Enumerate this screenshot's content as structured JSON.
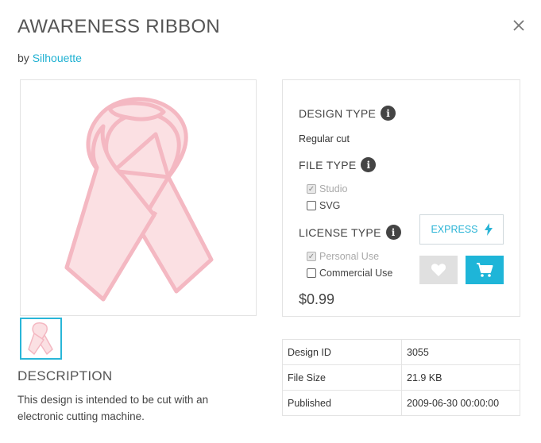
{
  "header": {
    "title": "AWARENESS RIBBON",
    "by_prefix": "by",
    "author": "Silhouette"
  },
  "colors": {
    "accent": "#1fb1d2",
    "ribbon_fill": "#fbe0e3",
    "ribbon_stroke": "#f4b8c2",
    "text": "#444444"
  },
  "description": {
    "title": "DESCRIPTION",
    "text": "This design is intended to be cut with an electronic cutting machine."
  },
  "options": {
    "design_type": {
      "label": "DESIGN TYPE",
      "value": "Regular cut",
      "info_icon": "info-icon"
    },
    "file_type": {
      "label": "FILE TYPE",
      "items": [
        {
          "label": "Studio",
          "checked": true,
          "disabled": true
        },
        {
          "label": "SVG",
          "checked": false,
          "disabled": false
        }
      ]
    },
    "license_type": {
      "label": "LICENSE TYPE",
      "items": [
        {
          "label": "Personal Use",
          "checked": true,
          "disabled": true
        },
        {
          "label": "Commercial Use",
          "checked": false,
          "disabled": false
        }
      ]
    },
    "price": "$0.99",
    "express_label": "EXPRESS",
    "icons": {
      "express": "lightning-icon",
      "favorite": "heart-icon",
      "cart": "cart-icon",
      "close": "close-icon"
    }
  },
  "details": [
    {
      "key": "Design ID",
      "value": "3055"
    },
    {
      "key": "File Size",
      "value": "21.9 KB"
    },
    {
      "key": "Published",
      "value": "2009-06-30 00:00:00"
    }
  ]
}
